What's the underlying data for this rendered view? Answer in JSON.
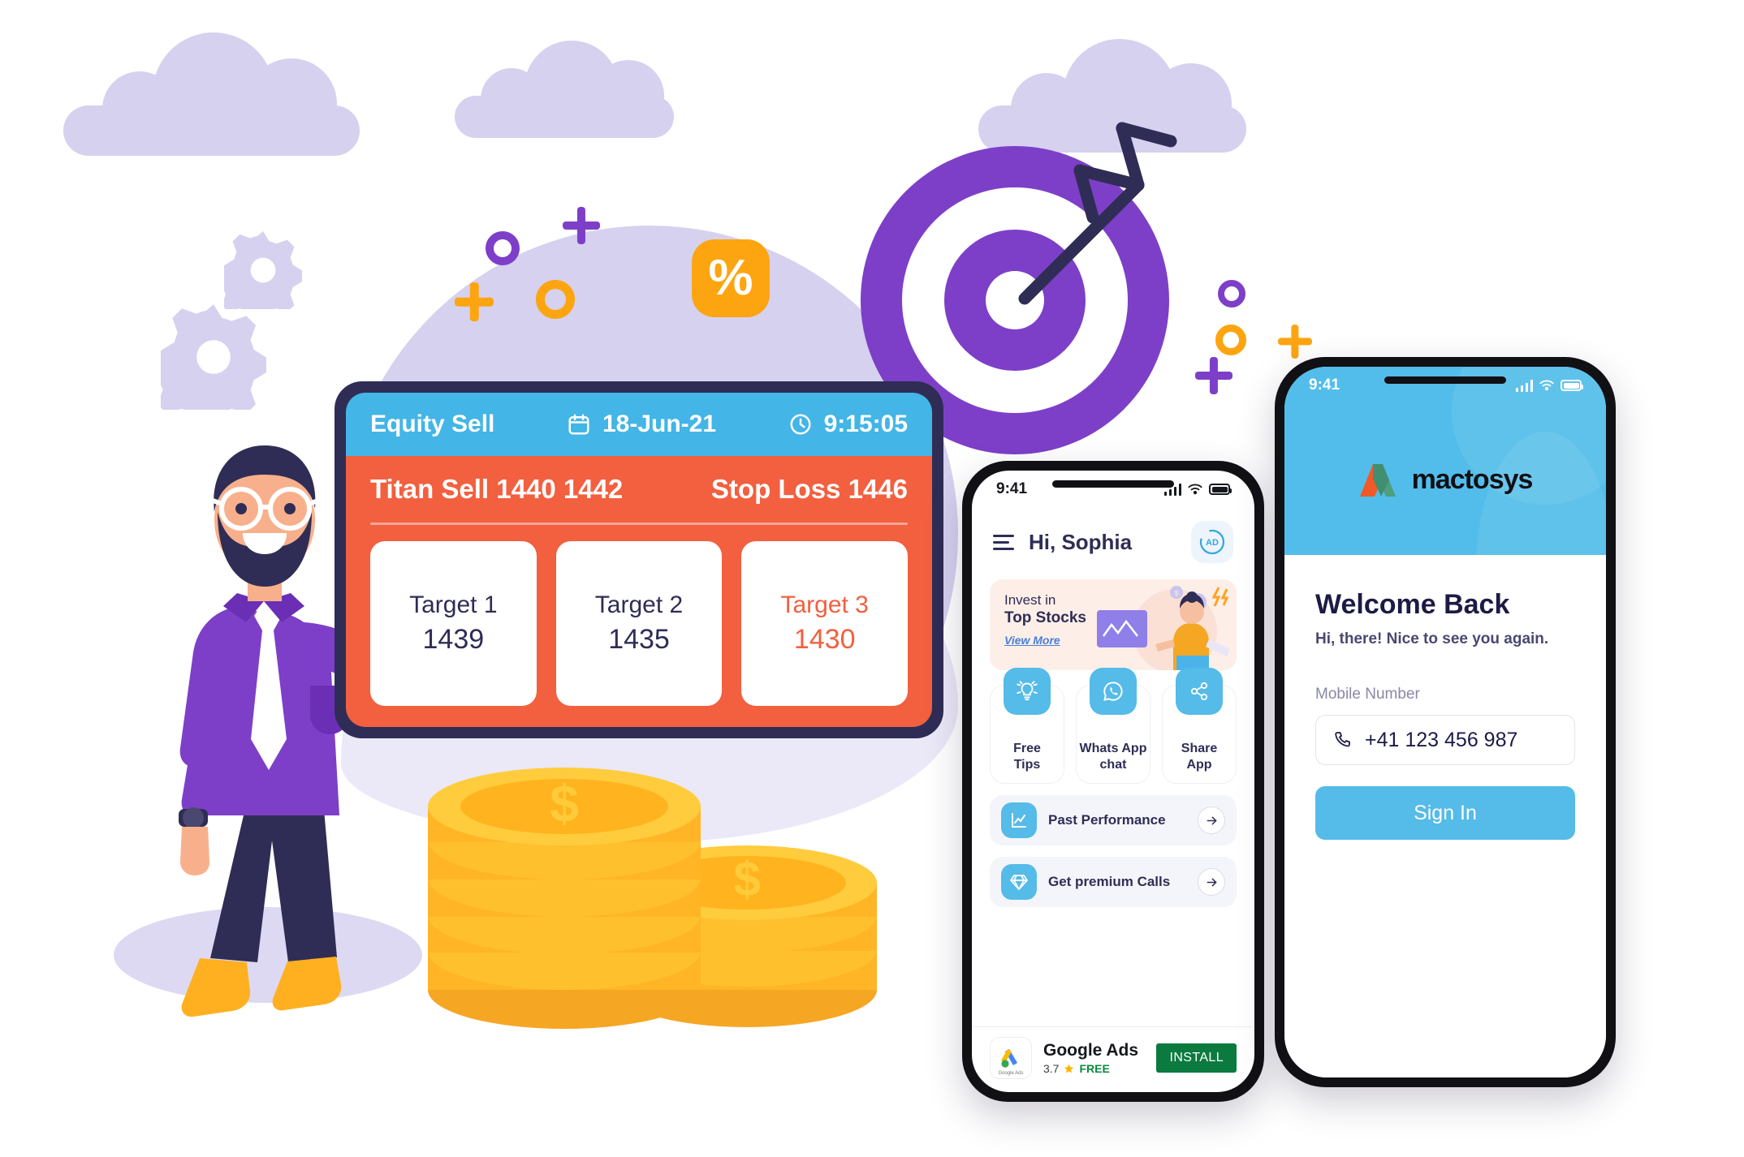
{
  "trading_card": {
    "header": {
      "title": "Equity Sell",
      "calendar_icon": "calendar-icon",
      "date": "18-Jun-21",
      "clock_icon": "clock-icon",
      "time": "9:15:05"
    },
    "call_text": "Titan Sell 1440 1442",
    "stop_loss": "Stop Loss 1446",
    "targets": [
      {
        "label": "Target 1",
        "value": "1439",
        "highlight": false
      },
      {
        "label": "Target 2",
        "value": "1435",
        "highlight": false
      },
      {
        "label": "Target 3",
        "value": "1430",
        "highlight": true
      }
    ],
    "colors": {
      "header_bg": "#43b5e6",
      "body_bg": "#f2603f",
      "frame": "#2f2d55",
      "highlight": "#f2603f"
    }
  },
  "middle_phone": {
    "status_bar": {
      "time": "9:41",
      "signal_icon": "signal-bars-icon",
      "wifi_icon": "wifi-icon",
      "battery_icon": "battery-icon"
    },
    "menu_icon": "hamburger-menu-icon",
    "greeting": "Hi, Sophia",
    "ad_badge": "AD",
    "promo": {
      "line1": "Invest in",
      "line2": "Top Stocks",
      "link": "View More"
    },
    "tiles": [
      {
        "label": "Free\nTips",
        "label_line1": "Free",
        "label_line2": "Tips",
        "icon": "lightbulb-tips-icon"
      },
      {
        "label_line1": "Whats App",
        "label_line2": "chat",
        "icon": "whatsapp-icon"
      },
      {
        "label_line1": "Share",
        "label_line2": "App",
        "icon": "share-icon"
      }
    ],
    "list_rows": [
      {
        "label": "Past Performance",
        "icon": "line-chart-icon",
        "arrow": "arrow-right-icon"
      },
      {
        "label": "Get premium Calls",
        "icon": "diamond-icon",
        "arrow": "arrow-right-icon"
      }
    ],
    "ad_banner": {
      "app_icon": "google-ads-icon",
      "app_icon_caption": "Google Ads",
      "title": "Google Ads",
      "rating": "3.7",
      "star_icon": "star-icon",
      "price": "FREE",
      "install_label": "INSTALL",
      "install_color": "#0b7a3f"
    }
  },
  "right_phone": {
    "status_bar": {
      "time": "9:41",
      "signal_icon": "signal-bars-icon",
      "wifi_icon": "wifi-icon",
      "battery_icon": "battery-icon"
    },
    "brand": {
      "logo_icon": "mactosys-m-logo-icon",
      "name": "mactosys"
    },
    "heading": "Welcome Back",
    "subheading": "Hi, there! Nice to see you again.",
    "field_label": "Mobile Number",
    "phone_icon": "phone-handset-icon",
    "phone_value": "+41  123 456 987",
    "phone_placeholder": "Mobile Number",
    "sign_in_label": "Sign In",
    "colors": {
      "header_bg": "#52bdea",
      "button_bg": "#55bbe8"
    }
  },
  "decor": {
    "percent_badge": "%",
    "gear_icon": "gear-icon",
    "dartboard_icon": "dartboard-target-icon",
    "arrow_icon": "arrow-dart-icon",
    "coins_icon": "dollar-coins-stack-icon",
    "man_icon": "businessman-presenter-icon",
    "cloud_icon": "cloud-icon",
    "colors": {
      "lavender": "#d6d1ef",
      "lavender_light": "#ebe8f8",
      "purple": "#7d3fc8",
      "orange": "#fda510",
      "navy": "#2f2d55",
      "gold": "#ffc02e"
    }
  }
}
